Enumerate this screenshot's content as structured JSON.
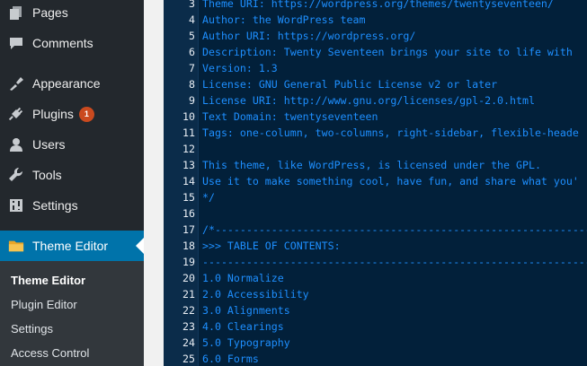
{
  "sidebar": {
    "items": [
      {
        "label": "Pages",
        "icon": "pages-icon"
      },
      {
        "label": "Comments",
        "icon": "comments-icon"
      },
      {
        "label": "Appearance",
        "icon": "appearance-icon"
      },
      {
        "label": "Plugins",
        "icon": "plugins-icon",
        "badge": "1"
      },
      {
        "label": "Users",
        "icon": "users-icon"
      },
      {
        "label": "Tools",
        "icon": "tools-icon"
      },
      {
        "label": "Settings",
        "icon": "settings-icon"
      },
      {
        "label": "Theme Editor",
        "icon": "folder-icon",
        "current": true
      }
    ],
    "submenu": [
      {
        "label": "Theme Editor",
        "active": true
      },
      {
        "label": "Plugin Editor"
      },
      {
        "label": "Settings"
      },
      {
        "label": "Access Control"
      }
    ]
  },
  "editor": {
    "lines": [
      {
        "n": "3",
        "text": "Theme URI: https://wordpress.org/themes/twentyseventeen/"
      },
      {
        "n": "4",
        "text": "Author: the WordPress team"
      },
      {
        "n": "5",
        "text": "Author URI: https://wordpress.org/"
      },
      {
        "n": "6",
        "text": "Description: Twenty Seventeen brings your site to life with"
      },
      {
        "n": "7",
        "text": "Version: 1.3"
      },
      {
        "n": "8",
        "text": "License: GNU General Public License v2 or later"
      },
      {
        "n": "9",
        "text": "License URI: http://www.gnu.org/licenses/gpl-2.0.html"
      },
      {
        "n": "10",
        "text": "Text Domain: twentyseventeen"
      },
      {
        "n": "11",
        "text": "Tags: one-column, two-columns, right-sidebar, flexible-heade"
      },
      {
        "n": "12",
        "text": ""
      },
      {
        "n": "13",
        "text": "This theme, like WordPress, is licensed under the GPL."
      },
      {
        "n": "14",
        "text": "Use it to make something cool, have fun, and share what you'"
      },
      {
        "n": "15",
        "text": "*/"
      },
      {
        "n": "16",
        "text": ""
      },
      {
        "n": "17",
        "text": "/*-------------------------------------------------------------"
      },
      {
        "n": "18",
        "text": ">>> TABLE OF CONTENTS:"
      },
      {
        "n": "19",
        "text": "---------------------------------------------------------------"
      },
      {
        "n": "20",
        "text": "1.0 Normalize"
      },
      {
        "n": "21",
        "text": "2.0 Accessibility"
      },
      {
        "n": "22",
        "text": "3.0 Alignments"
      },
      {
        "n": "23",
        "text": "4.0 Clearings"
      },
      {
        "n": "24",
        "text": "5.0 Typography"
      },
      {
        "n": "25",
        "text": "6.0 Forms"
      }
    ]
  },
  "colors": {
    "sidebar_bg": "#23282d",
    "submenu_bg": "#32373c",
    "current_bg": "#0073aa",
    "badge_bg": "#ca4a1f",
    "editor_bg": "#02203a",
    "code_text": "#1e8fff",
    "line_number": "#e9eef4"
  }
}
